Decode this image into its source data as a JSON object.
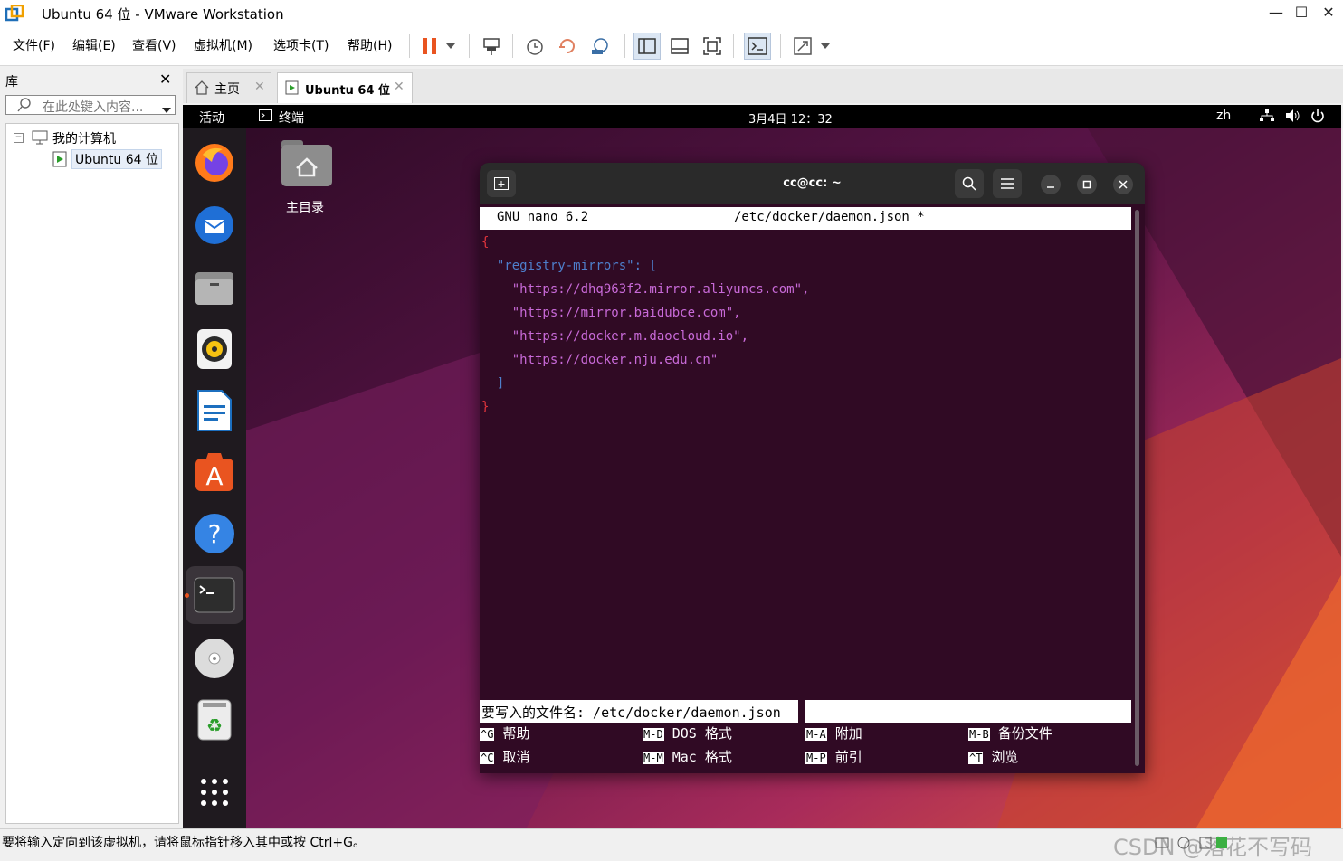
{
  "window": {
    "title": "Ubuntu 64 位 - VMware Workstation",
    "minimize": "—",
    "maximize": "☐",
    "close": "✕"
  },
  "menu": [
    "文件(F)",
    "编辑(E)",
    "查看(V)",
    "虚拟机(M)",
    "选项卡(T)",
    "帮助(H)"
  ],
  "library": {
    "title": "库",
    "search_placeholder": "在此处键入内容...",
    "tree_root": "我的计算机",
    "tree_child": "Ubuntu 64 位"
  },
  "tabs": [
    {
      "label": "主页"
    },
    {
      "label": "Ubuntu 64 位"
    }
  ],
  "vm": {
    "activities": "活动",
    "app_name": "终端",
    "clock": "3月4日  12：32",
    "lang": "zh",
    "desktop_icon_label": "主目录",
    "terminal": {
      "title": "cc@cc: ~",
      "nano_version": "GNU nano 6.2",
      "file_path": "/etc/docker/daemon.json *",
      "code_lines": [
        "{",
        "  \"registry-mirrors\": [",
        "    \"https://dhq963f2.mirror.aliyuncs.com\",",
        "    \"https://mirror.baidubce.com\",",
        "    \"https://docker.m.daocloud.io\",",
        "    \"https://docker.nju.edu.cn\"",
        "  ]",
        "}"
      ],
      "prompt": "要写入的文件名: /etc/docker/daemon.json",
      "shortcuts": [
        {
          "key": "^G",
          "label": "帮助"
        },
        {
          "key": "M-D",
          "label": "DOS 格式"
        },
        {
          "key": "M-A",
          "label": "附加"
        },
        {
          "key": "M-B",
          "label": "备份文件"
        },
        {
          "key": "^C",
          "label": "取消"
        },
        {
          "key": "M-M",
          "label": "Mac 格式"
        },
        {
          "key": "M-P",
          "label": "前引"
        },
        {
          "key": "^T",
          "label": "浏览"
        }
      ]
    }
  },
  "statusbar": {
    "text": "要将输入定向到该虚拟机，请将鼠标指针移入其中或按 Ctrl+G。",
    "watermark": "CSDN @落花不写码"
  },
  "colors": {
    "accent_orange": "#e95420",
    "terminal_bg": "#300a24",
    "json_key": "#3d6fb8",
    "json_string": "#b44fc6",
    "json_brace": "#c42e2e"
  }
}
